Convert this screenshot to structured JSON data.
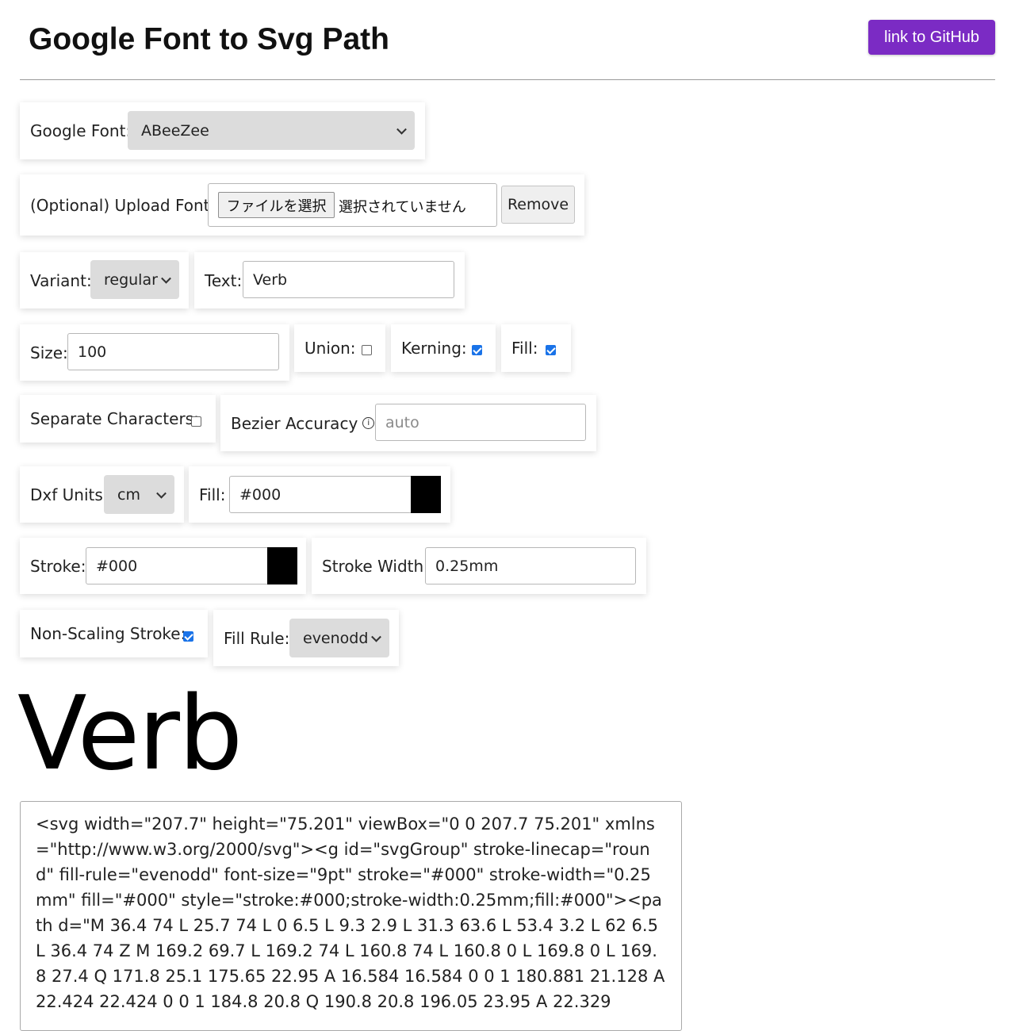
{
  "header": {
    "title": "Google Font to Svg Path",
    "github_label": "link to GitHub"
  },
  "google_font": {
    "label": "Google Font:",
    "selected": "ABeeZee"
  },
  "upload_font": {
    "label": "(Optional) Upload Font:",
    "file_button": "ファイルを選択",
    "file_status": "選択されていません",
    "remove_label": "Remove"
  },
  "variant": {
    "label": "Variant:",
    "selected": "regular"
  },
  "text": {
    "label": "Text:",
    "value": "Verb"
  },
  "size": {
    "label": "Size:",
    "value": "100"
  },
  "union": {
    "label": "Union:",
    "checked": false
  },
  "kerning": {
    "label": "Kerning:",
    "checked": true
  },
  "fill_toggle": {
    "label": "Fill:",
    "checked": true
  },
  "separate_characters": {
    "label": "Separate Characters:",
    "checked": false
  },
  "bezier_accuracy": {
    "label": "Bezier Accuracy",
    "suffix": ":",
    "info_glyph": "i",
    "placeholder": "auto"
  },
  "dxf_units": {
    "label": "Dxf Units:",
    "selected": "cm"
  },
  "fill_color": {
    "label": "Fill:",
    "value": "#000",
    "swatch": "#000000"
  },
  "stroke": {
    "label": "Stroke:",
    "value": "#000",
    "swatch": "#000000"
  },
  "stroke_width": {
    "label": "Stroke Width:",
    "value": "0.25mm"
  },
  "non_scaling_stroke": {
    "label": "Non-Scaling Stroke:",
    "checked": true
  },
  "fill_rule": {
    "label": "Fill Rule:",
    "selected": "evenodd"
  },
  "preview": {
    "text": "Verb"
  },
  "output": {
    "svg": "<svg width=\"207.7\" height=\"75.201\" viewBox=\"0 0 207.7 75.201\" xmlns=\"http://www.w3.org/2000/svg\"><g id=\"svgGroup\" stroke-linecap=\"round\" fill-rule=\"evenodd\" font-size=\"9pt\" stroke=\"#000\" stroke-width=\"0.25mm\" fill=\"#000\" style=\"stroke:#000;stroke-width:0.25mm;fill:#000\"><path d=\"M 36.4 74 L 25.7 74 L 0 6.5 L 9.3 2.9 L 31.3 63.6 L 53.4 3.2 L 62 6.5 L 36.4 74 Z M 169.2 69.7 L 169.2 74 L 160.8 74 L 160.8 0 L 169.8 0 L 169.8 27.4 Q 171.8 25.1 175.65 22.95 A 16.584 16.584 0 0 1 180.881 21.128 A 22.424 22.424 0 0 1 184.8 20.8 Q 190.8 20.8 196.05 23.95 A 22.329"
  }
}
